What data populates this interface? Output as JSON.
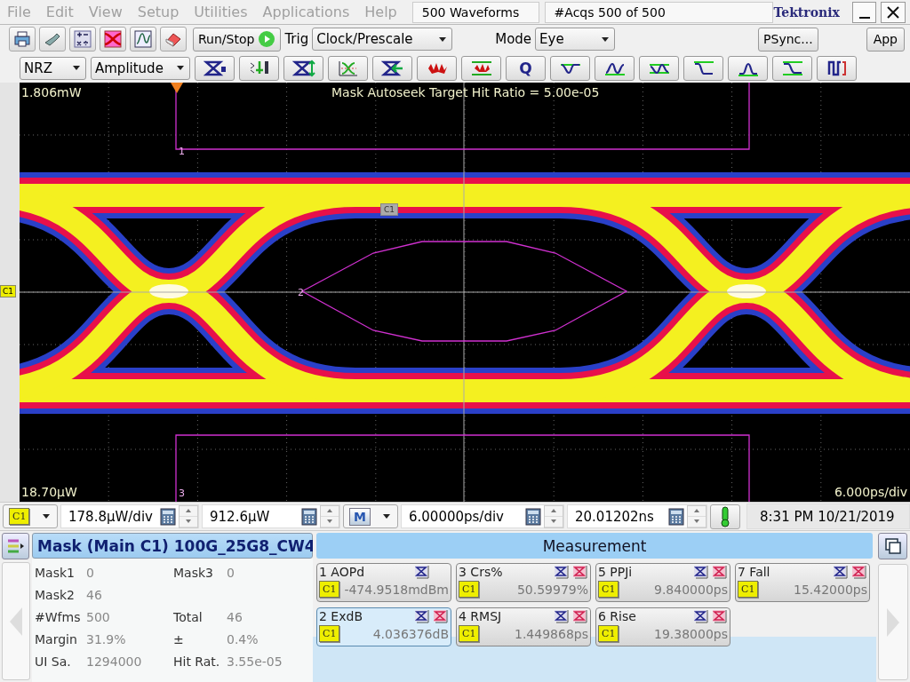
{
  "menu": [
    "File",
    "Edit",
    "View",
    "Setup",
    "Utilities",
    "Applications",
    "Help"
  ],
  "status_fields": [
    "500 Waveforms",
    "#Acqs  500 of 500"
  ],
  "brand": "Tektronix",
  "toolbar": {
    "run_stop": "Run/Stop",
    "trig_label": "Trig",
    "trig_value": "Clock/Prescale",
    "mode_label": "Mode",
    "mode_value": "Eye",
    "psync": "PSync...",
    "app": "App"
  },
  "toolbar2": {
    "encoding": "NRZ",
    "scale": "Amplitude",
    "q_button": "Q"
  },
  "scope": {
    "top_level": "1.806mW",
    "message": "Mask Autoseek Target Hit Ratio = 5.00e-05",
    "bottom_level": "18.70μW",
    "timebase": "6.000ps/div",
    "channel_marker": "C1",
    "channel_tag": "C1",
    "mask_labels": [
      "1",
      "2",
      "3"
    ]
  },
  "control_bar": {
    "channel": "C1",
    "vertical_scale": "178.8μW/div",
    "offset": "912.6μW",
    "mode_badge": "M",
    "horizontal_scale": "6.00000ps/div",
    "position": "20.01202ns",
    "datetime": "8:31 PM 10/21/2019"
  },
  "mask_panel": {
    "title": "Mask (Main  C1) 100G_25G8_CW4",
    "rows": [
      {
        "cells": [
          {
            "label": "Mask1",
            "value": "0"
          },
          {
            "label": "Mask3",
            "value": "0"
          }
        ]
      },
      {
        "cells": [
          {
            "label": "Mask2",
            "value": "46"
          }
        ]
      },
      {
        "cells": [
          {
            "label": "#Wfms",
            "value": "500"
          },
          {
            "label": "Total",
            "value": "46"
          }
        ]
      },
      {
        "cells": [
          {
            "label": "Margin",
            "value": "31.9%"
          },
          {
            "label": "±",
            "value": "0.4%"
          }
        ]
      },
      {
        "cells": [
          {
            "label": "UI Sa.",
            "value": "1294000"
          },
          {
            "label": "Hit Rat.",
            "value": "3.55e-05"
          }
        ]
      }
    ]
  },
  "measurement": {
    "title": "Measurement",
    "items": [
      {
        "label": "1 AOPd",
        "channel": "C1",
        "value": "-474.9518mdBm",
        "selected": false,
        "extra_icon": false
      },
      {
        "label": "2 ExdB",
        "channel": "C1",
        "value": "4.036376dB",
        "selected": true,
        "extra_icon": true
      },
      {
        "label": "3 Crs%",
        "channel": "C1",
        "value": "50.59979%",
        "selected": false,
        "extra_icon": true
      },
      {
        "label": "4 RMSJ",
        "channel": "C1",
        "value": "1.449868ps",
        "selected": false,
        "extra_icon": true
      },
      {
        "label": "5 PPJi",
        "channel": "C1",
        "value": "9.840000ps",
        "selected": false,
        "extra_icon": true
      },
      {
        "label": "6 Rise",
        "channel": "C1",
        "value": "19.38000ps",
        "selected": false,
        "extra_icon": true
      },
      {
        "label": "7 Fall",
        "channel": "C1",
        "value": "15.42000ps",
        "selected": false,
        "extra_icon": true
      }
    ]
  }
}
